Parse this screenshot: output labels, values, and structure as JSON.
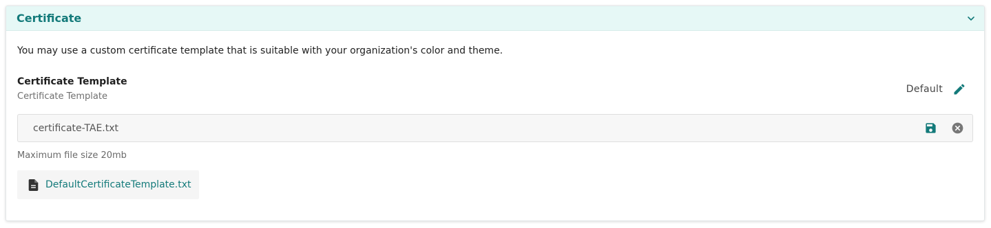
{
  "section": {
    "title": "Certificate",
    "description": "You may use a custom certificate template that is suitable with your organization's color and theme."
  },
  "template_field": {
    "label": "Certificate Template",
    "sublabel": "Certificate Template",
    "status": "Default",
    "input_value": "certificate-TAE.txt",
    "max_size_note": "Maximum file size 20mb"
  },
  "attachment": {
    "filename": "DefaultCertificateTemplate.txt"
  },
  "icons": {
    "collapse": "chevron-down-icon",
    "edit": "pencil-icon",
    "save": "floppy-disk-icon",
    "clear": "close-circle-icon",
    "file": "document-icon"
  },
  "colors": {
    "accent": "#137a7a",
    "header_bg": "#e6f8f6",
    "clear_icon": "#777777"
  }
}
